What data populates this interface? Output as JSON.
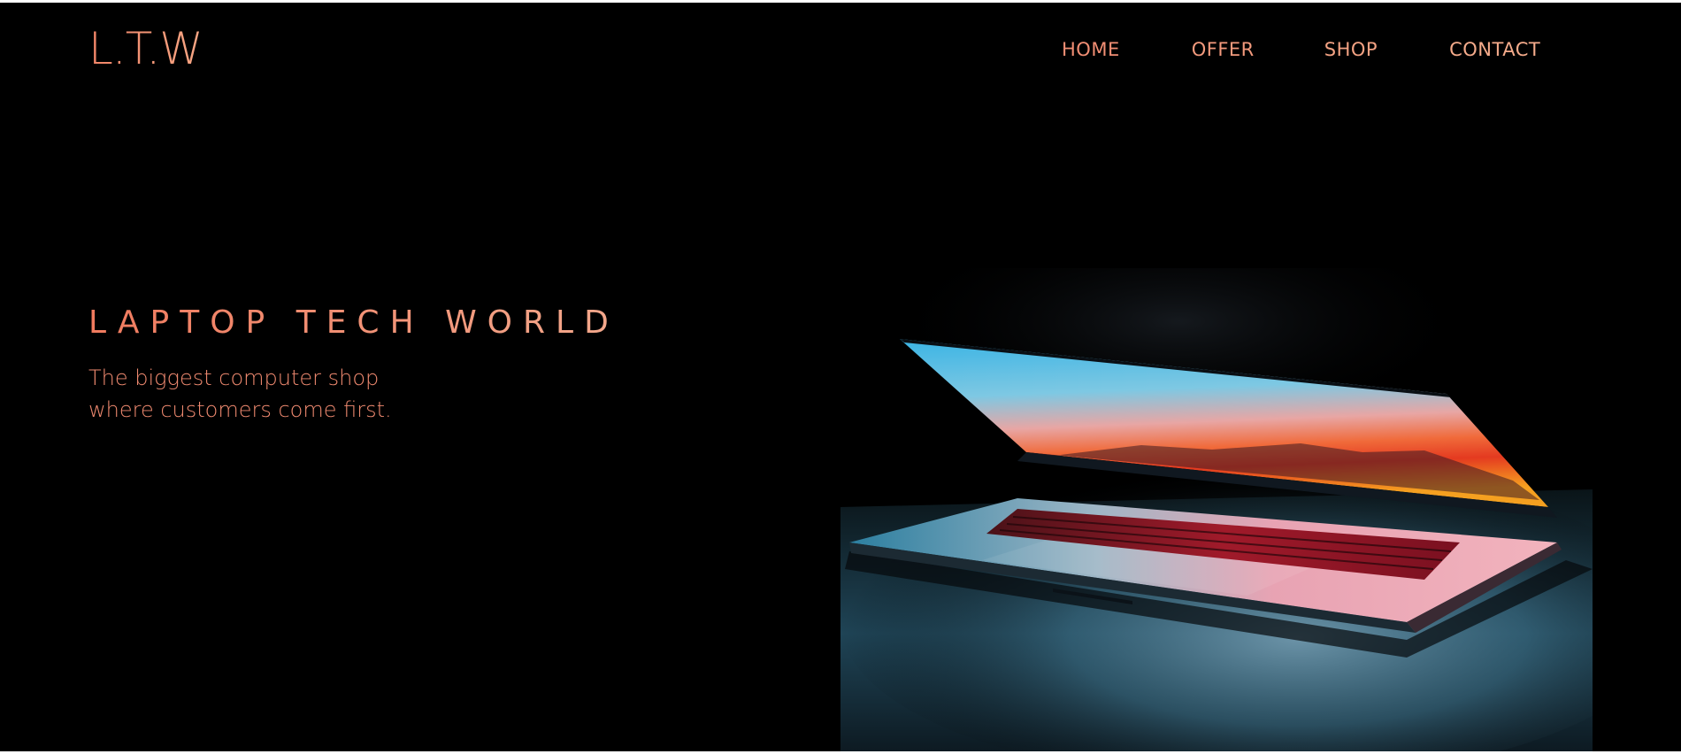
{
  "brand": {
    "logo_text": "L.T.W"
  },
  "nav": {
    "items": [
      {
        "label": "HOME"
      },
      {
        "label": "OFFER"
      },
      {
        "label": "SHOP"
      },
      {
        "label": "CONTACT"
      }
    ]
  },
  "hero": {
    "title": "LAPTOP TECH WORLD",
    "subtitle_line1": "The biggest computer shop",
    "subtitle_line2": "where customers come first."
  },
  "colors": {
    "background": "#000000",
    "accent": "#f28467",
    "accent_light": "#f5ab8b"
  }
}
